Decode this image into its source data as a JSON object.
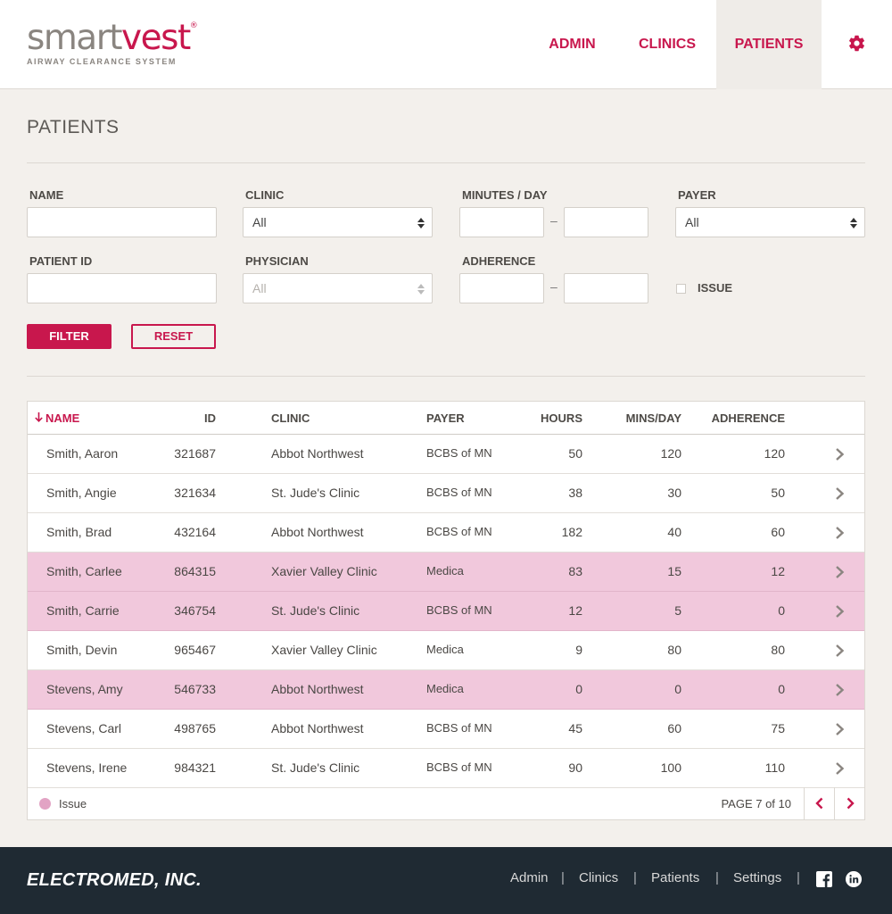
{
  "brand": {
    "logo_part1": "smart",
    "logo_part2": "vest",
    "logo_reg": "®",
    "tagline": "AIRWAY CLEARANCE SYSTEM",
    "accent_color": "#c8174d"
  },
  "nav": {
    "admin": "ADMIN",
    "clinics": "CLINICS",
    "patients": "PATIENTS",
    "active": "patients",
    "settings_icon": "gear-icon"
  },
  "page": {
    "title": "PATIENTS"
  },
  "filters": {
    "name_label": "NAME",
    "name_value": "",
    "clinic_label": "CLINIC",
    "clinic_value": "All",
    "minutes_label": "MINUTES / DAY",
    "minutes_min": "",
    "minutes_max": "",
    "range_dash": "–",
    "payer_label": "PAYER",
    "payer_value": "All",
    "patient_id_label": "PATIENT ID",
    "patient_id_value": "",
    "physician_label": "PHYSICIAN",
    "physician_value": "All",
    "adherence_label": "ADHERENCE",
    "adherence_min": "",
    "adherence_max": "",
    "issue_label": "ISSUE",
    "issue_checked": false,
    "filter_button": "FILTER",
    "reset_button": "RESET"
  },
  "table": {
    "columns": {
      "name": "NAME",
      "id": "ID",
      "clinic": "CLINIC",
      "payer": "PAYER",
      "hours": "HOURS",
      "mins": "MINS/DAY",
      "adherence": "ADHERENCE"
    },
    "sort_column": "name",
    "rows": [
      {
        "name": "Smith, Aaron",
        "id": "321687",
        "clinic": "Abbot Northwest",
        "payer": "BCBS of MN",
        "hours": "50",
        "mins": "120",
        "adherence": "120",
        "issue": false
      },
      {
        "name": "Smith, Angie",
        "id": "321634",
        "clinic": "St. Jude's Clinic",
        "payer": "BCBS of MN",
        "hours": "38",
        "mins": "30",
        "adherence": "50",
        "issue": false
      },
      {
        "name": "Smith, Brad",
        "id": "432164",
        "clinic": "Abbot Northwest",
        "payer": "BCBS of MN",
        "hours": "182",
        "mins": "40",
        "adherence": "60",
        "issue": false
      },
      {
        "name": "Smith, Carlee",
        "id": "864315",
        "clinic": "Xavier Valley Clinic",
        "payer": "Medica",
        "hours": "83",
        "mins": "15",
        "adherence": "12",
        "issue": true
      },
      {
        "name": "Smith, Carrie",
        "id": "346754",
        "clinic": "St. Jude's Clinic",
        "payer": "BCBS of MN",
        "hours": "12",
        "mins": "5",
        "adherence": "0",
        "issue": true
      },
      {
        "name": "Smith, Devin",
        "id": "965467",
        "clinic": "Xavier Valley Clinic",
        "payer": "Medica",
        "hours": "9",
        "mins": "80",
        "adherence": "80",
        "issue": false
      },
      {
        "name": "Stevens, Amy",
        "id": "546733",
        "clinic": "Abbot Northwest",
        "payer": "Medica",
        "hours": "0",
        "mins": "0",
        "adherence": "0",
        "issue": true
      },
      {
        "name": "Stevens, Carl",
        "id": "498765",
        "clinic": "Abbot Northwest",
        "payer": "BCBS of MN",
        "hours": "45",
        "mins": "60",
        "adherence": "75",
        "issue": false
      },
      {
        "name": "Stevens, Irene",
        "id": "984321",
        "clinic": "St. Jude's Clinic",
        "payer": "BCBS of MN",
        "hours": "90",
        "mins": "100",
        "adherence": "110",
        "issue": false
      }
    ],
    "legend_label": "Issue",
    "issue_color": "#f1c8dc",
    "page_text": "PAGE 7 of 10"
  },
  "footer": {
    "company": "ELECTROMED, INC.",
    "links": [
      "Admin",
      "Clinics",
      "Patients",
      "Settings"
    ],
    "separator": "|",
    "social_icons": [
      "facebook-icon",
      "linkedin-icon"
    ]
  }
}
